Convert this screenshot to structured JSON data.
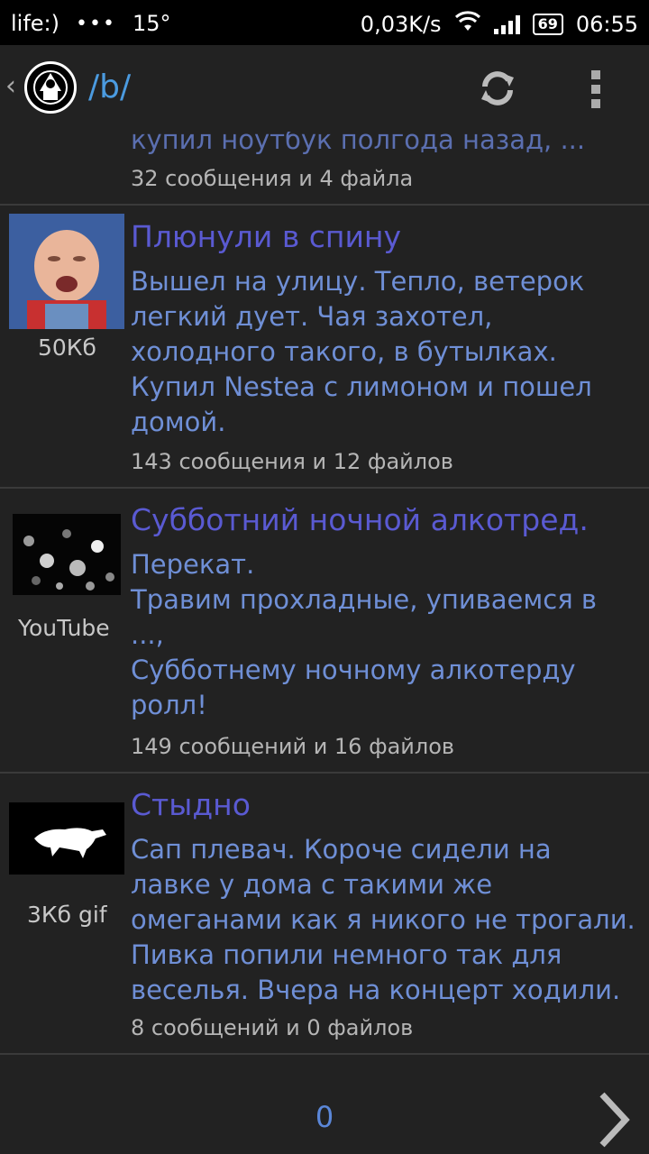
{
  "status_bar": {
    "carrier": "life:)",
    "dots": "•••",
    "temperature": "15°",
    "speed": "0,03K/s",
    "battery": "69",
    "time": "06:55"
  },
  "app_bar": {
    "board": "/b/",
    "logo_icon": "anonymous-logo-icon",
    "refresh_icon": "refresh-icon",
    "menu_icon": "overflow-menu-icon"
  },
  "threads": [
    {
      "subject": "",
      "body": "купил ноутбук полгода назад, ...",
      "stats": "32 сообщения и 4 файла",
      "thumb_label": ""
    },
    {
      "subject": "Плюнули в спину",
      "body": "Вышел на улицу. Тепло, ветерок\nлегкий дует. Чая захотел,\nхолодного такого, в бутылках.\nКупил Nestea с лимоном и пошел\nдомой.",
      "stats": "143 сообщения и 12 файлов",
      "thumb_label": "50Кб"
    },
    {
      "subject": "Субботний ночной алкотред.",
      "body": "Перекат.\nТравим прохладные, упиваемся в\n...,\nСубботнему ночному алкотерду\nролл!",
      "stats": "149 сообщений и 16 файлов",
      "thumb_label": "YouTube"
    },
    {
      "subject": "Стыдно",
      "body": "Сап плевач. Короче сидели на\nлавке у дома с такими же\nомеганами как я никого не трогали.\nПивка попили немного так для\nвеселья. Вчера на концерт ходили.",
      "stats": "8 сообщений и 0 файлов",
      "thumb_label": "3Кб gif"
    }
  ],
  "bottom_bar": {
    "page": "0",
    "next_icon": "chevron-right-icon"
  },
  "colors": {
    "background": "#222222",
    "subject": "#5a5ad2",
    "body": "#6f8fd6",
    "stats": "#b5b5b5",
    "accent": "#4b9be0"
  }
}
